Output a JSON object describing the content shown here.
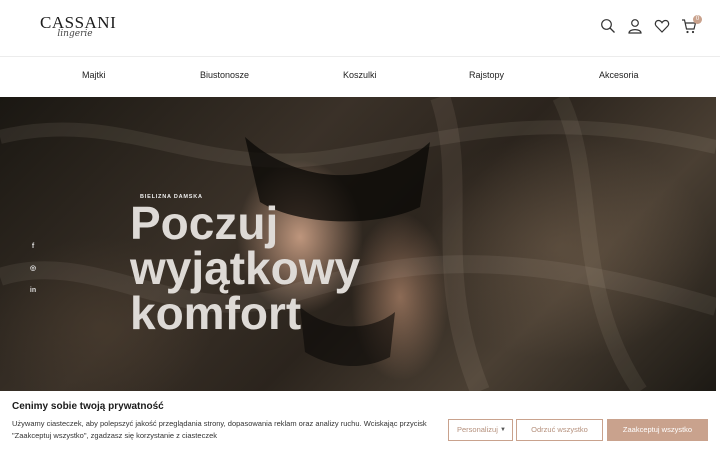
{
  "brand": {
    "name": "CASSANI",
    "tagline": "lingerie"
  },
  "header": {
    "icons": [
      "search-icon",
      "user-icon",
      "heart-icon",
      "cart-icon"
    ],
    "cart_count": "0"
  },
  "nav": {
    "items": [
      {
        "label": "Majtki"
      },
      {
        "label": "Biustonosze"
      },
      {
        "label": "Koszulki"
      },
      {
        "label": "Rajstopy"
      },
      {
        "label": "Akcesoria"
      }
    ]
  },
  "hero": {
    "kicker": "BIELIZNA DAMSKA",
    "title_lines": [
      "Poczuj",
      "wyjątkowy",
      "komfort"
    ],
    "social": [
      "f",
      "◎",
      "in"
    ]
  },
  "cookie": {
    "title": "Cenimy sobie twoją prywatność",
    "text": "Używamy ciasteczek, aby polepszyć jakość przeglądania strony, dopasowania reklam oraz analizy ruchu. Wciskając przycisk \"Zaakceptuj wszystko\", zgadzasz się korzystanie z ciasteczek",
    "personalize_label": "Personalizuj",
    "reject_label": "Odrzuć wszystko",
    "accept_label": "Zaakceptuj wszystko"
  },
  "colors": {
    "accent": "#c9a28d",
    "hero_text": "#dedad6"
  }
}
